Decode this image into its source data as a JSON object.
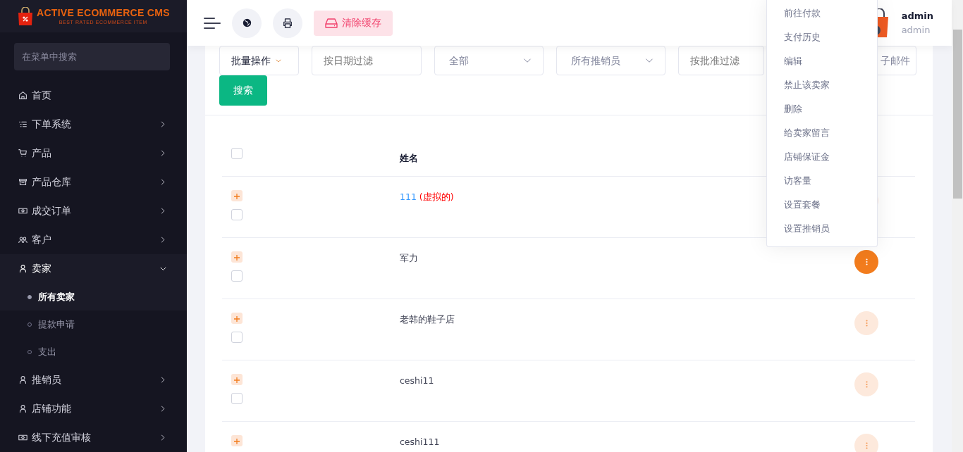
{
  "brand": {
    "title": "ACTIVE ECOMMERCE CMS",
    "tagline": "BEST RATED ECOMMERCE ITEM"
  },
  "sidebar": {
    "search": {
      "placeholder": "在菜单中搜索"
    },
    "items": [
      {
        "label": "首页",
        "kind": "link",
        "expanded": false
      },
      {
        "label": "下单系统",
        "kind": "group",
        "expanded": false
      },
      {
        "label": "产品",
        "kind": "group",
        "expanded": false
      },
      {
        "label": "产品仓库",
        "kind": "group",
        "expanded": false
      },
      {
        "label": "成交订单",
        "kind": "group",
        "expanded": false
      },
      {
        "label": "客户",
        "kind": "group",
        "expanded": false
      },
      {
        "label": "卖家",
        "kind": "group",
        "expanded": true,
        "children": [
          {
            "label": "所有卖家",
            "selected": true
          },
          {
            "label": "提款申请",
            "selected": false
          },
          {
            "label": "支出",
            "selected": false
          }
        ]
      },
      {
        "label": "推销员",
        "kind": "group",
        "expanded": false
      },
      {
        "label": "店铺功能",
        "kind": "group",
        "expanded": false
      },
      {
        "label": "线下充值审核",
        "kind": "group",
        "expanded": false
      }
    ]
  },
  "header": {
    "clear_cache": "清除缓存",
    "user": {
      "name": "admin",
      "role": "admin"
    }
  },
  "filters": [
    {
      "kind": "dropdown",
      "text": "批量操作"
    },
    {
      "kind": "input",
      "placeholder": "按日期过滤"
    },
    {
      "kind": "select",
      "text": "全部"
    },
    {
      "kind": "select",
      "text": "所有推销员"
    },
    {
      "kind": "input",
      "placeholder": "按批准过滤"
    },
    {
      "kind": "cut",
      "text": "子邮件"
    }
  ],
  "search_button": "搜索",
  "table": {
    "select_all_checked": false,
    "columns": [
      "姓名"
    ],
    "rows": [
      {
        "name": "111",
        "tag": "(虚拟的)",
        "checked": false,
        "selected": false
      },
      {
        "name": "军力",
        "checked": false,
        "selected": true
      },
      {
        "name": "老韩的鞋子店",
        "checked": false,
        "selected": false
      },
      {
        "name": "ceshi11",
        "checked": false,
        "selected": false
      },
      {
        "name": "ceshi111",
        "selected": false
      }
    ]
  },
  "action_menu": [
    "前往付款",
    "支付历史",
    "编辑",
    "禁止该卖家",
    "删除",
    "给卖家留言",
    "店铺保证金",
    "访客量",
    "设置套餐",
    "设置推销员"
  ]
}
